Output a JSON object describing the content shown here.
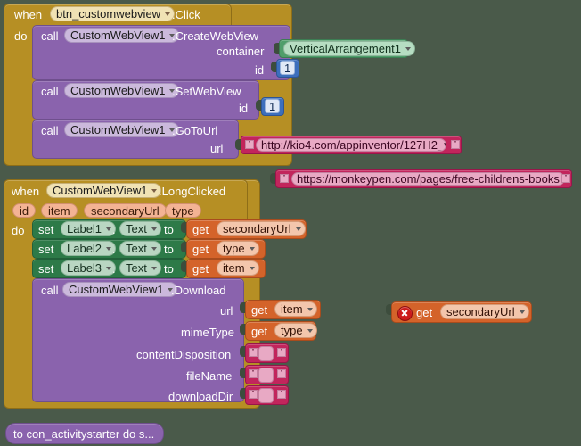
{
  "workspace": {
    "background_color": "#4a5a4a",
    "name": "App Inventor Blocks Editor canvas"
  },
  "blocks": {
    "event_click": {
      "keyword_when": "when",
      "component": "btn_customwebview",
      "event": ".Click",
      "keyword_do": "do",
      "statements": [
        {
          "keyword_call": "call",
          "component": "CustomWebView1",
          "method": ".CreateWebView",
          "args": [
            {
              "name": "container",
              "value": "VerticalArrangement1",
              "kind": "component-dropdown"
            },
            {
              "name": "id",
              "value": "1",
              "kind": "number"
            }
          ]
        },
        {
          "keyword_call": "call",
          "component": "CustomWebView1",
          "method": ".SetWebView",
          "args": [
            {
              "name": "id",
              "value": "1",
              "kind": "number"
            }
          ]
        },
        {
          "keyword_call": "call",
          "component": "CustomWebView1",
          "method": ".GoToUrl",
          "args": [
            {
              "name": "url",
              "value": "http://kio4.com/appinventor/127H2_visorweb_custo...",
              "kind": "text"
            }
          ]
        }
      ]
    },
    "floating_text": {
      "value": "https://monkeypen.com/pages/free-childrens-books",
      "kind": "text"
    },
    "event_longclicked": {
      "keyword_when": "when",
      "component": "CustomWebView1",
      "event": ".LongClicked",
      "params": [
        "id",
        "item",
        "secondaryUrl",
        "type"
      ],
      "keyword_do": "do",
      "setters": [
        {
          "keyword_set": "set",
          "component": "Label1",
          "dot": ".",
          "property": "Text",
          "keyword_to": "to",
          "value_keyword": "get",
          "value": "secondaryUrl"
        },
        {
          "keyword_set": "set",
          "component": "Label2",
          "dot": ".",
          "property": "Text",
          "keyword_to": "to",
          "value_keyword": "get",
          "value": "type"
        },
        {
          "keyword_set": "set",
          "component": "Label3",
          "dot": ".",
          "property": "Text",
          "keyword_to": "to",
          "value_keyword": "get",
          "value": "item"
        }
      ],
      "download_call": {
        "keyword_call": "call",
        "component": "CustomWebView1",
        "method": ".Download",
        "args": [
          {
            "name": "url",
            "kind": "getter",
            "value_keyword": "get",
            "value": "item"
          },
          {
            "name": "mimeType",
            "kind": "getter",
            "value_keyword": "get",
            "value": "type"
          },
          {
            "name": "contentDisposition",
            "kind": "empty-text",
            "value": ""
          },
          {
            "name": "fileName",
            "kind": "empty-text",
            "value": ""
          },
          {
            "name": "downloadDir",
            "kind": "empty-text",
            "value": ""
          }
        ]
      }
    },
    "orphan_getter": {
      "keyword_get": "get",
      "value": "secondaryUrl",
      "badge": "error-x-icon",
      "has_error": true
    },
    "collapsed_procedure": {
      "label": "to con_activitystarter do s..."
    }
  },
  "colors": {
    "event": "#b68f24",
    "method": "#8a63ad",
    "setter": "#2d7a48",
    "getter": "#d4632a",
    "text": "#c2255c",
    "number": "#3c6fbd",
    "error": "#cc1b1b",
    "canvas": "#4a5a4a"
  }
}
